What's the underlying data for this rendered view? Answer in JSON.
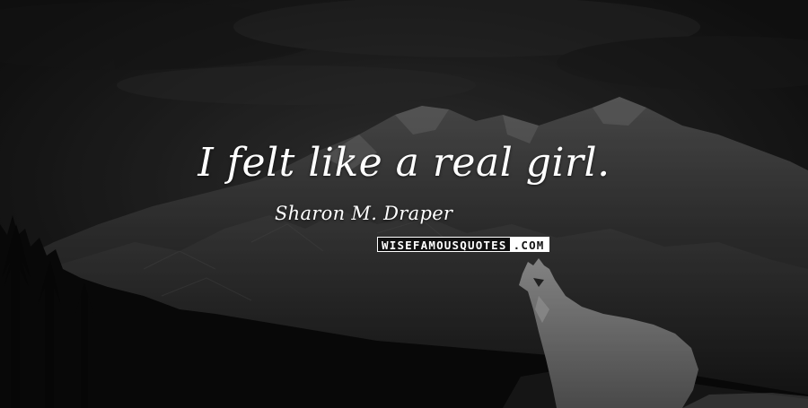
{
  "quote": {
    "text": "I felt like a real girl.",
    "author": "Sharon M. Draper"
  },
  "watermark": {
    "brand": "WISEFAMOUSQUOTES",
    "tld": ".COM"
  },
  "background": {
    "scene": "night-mountains-with-wolf",
    "colors": {
      "sky": "#232323",
      "mountain": "#3a3a3a",
      "snow": "#8a8a8a",
      "forest": "#0c0c0c",
      "wolf": "#9a9a9a"
    }
  }
}
